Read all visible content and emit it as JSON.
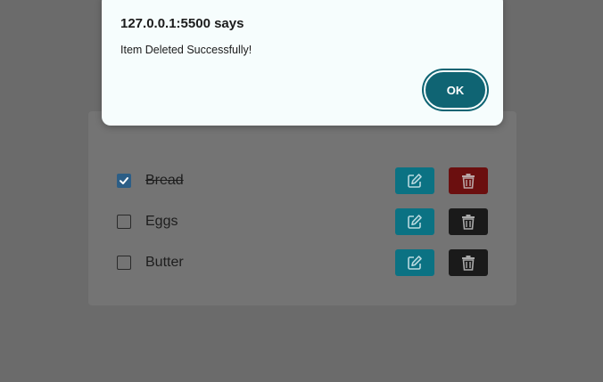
{
  "dialog": {
    "title": "127.0.0.1:5500 says",
    "message": "Item Deleted Successfully!",
    "ok_label": "OK"
  },
  "todo": {
    "items": [
      {
        "label": "Bread",
        "checked": true
      },
      {
        "label": "Eggs",
        "checked": false
      },
      {
        "label": "Butter",
        "checked": false
      }
    ]
  },
  "colors": {
    "overlay": "#6b6b6b",
    "edit_button": "#0b7283",
    "delete_button": "#1a1a1a",
    "delete_button_highlight": "#6b0f0f",
    "ok_button": "#0f6473",
    "checkbox_checked": "#2c5e86"
  },
  "icons": {
    "edit": "pencil-square-icon",
    "delete": "trash-icon",
    "check": "checkmark-icon"
  }
}
